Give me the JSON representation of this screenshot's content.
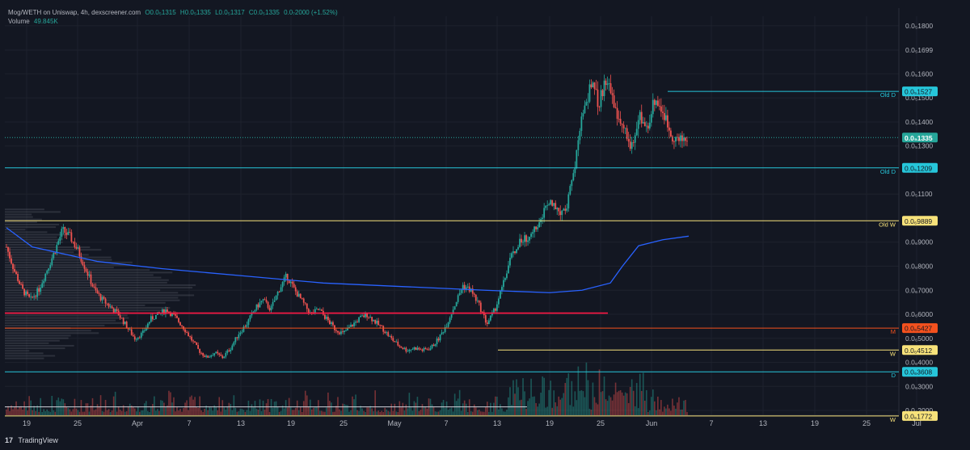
{
  "header": {
    "symbol": "Mog/WETH on Uniswap, 4h, dexscreener.com",
    "open": "O0.0₅1315",
    "high": "H0.0₅1335",
    "low": "L0.0₅1317",
    "close": "C0.0₅1335",
    "change": "0.0₇2000 (+1.52%)",
    "volume_label": "Volume",
    "volume_value": "49.845K"
  },
  "footer": {
    "logo": "17",
    "brand": "TradingView"
  },
  "colors": {
    "bg": "#131722",
    "up": "#26a69a",
    "down": "#ef5350",
    "ma": "#2962ff",
    "cyan": "#26c6da",
    "yellow": "#f7e27a",
    "orange": "#f4511e",
    "red": "#ff1744",
    "grid": "#1e222d"
  },
  "chart_data": {
    "type": "candlestick",
    "timeframe": "4h",
    "x_ticks": [
      "19",
      "25",
      "Apr",
      "7",
      "13",
      "19",
      "25",
      "May",
      "7",
      "13",
      "19",
      "25",
      "Jun",
      "7",
      "13",
      "19",
      "25",
      "Jul"
    ],
    "y_ticks": [
      "0.0₅1800",
      "0.0₅1699",
      "0.0₅1600",
      "0.0₅1500",
      "0.0₅1400",
      "0.0₅1300",
      "0.0₅1100",
      "0.0₆9000",
      "0.0₆8000",
      "0.0₆7000",
      "0.0₆6000",
      "0.0₆5000",
      "0.0₆4000",
      "0.0₆3000",
      "0.0₆2000"
    ],
    "y_tick_values": [
      1.8,
      1.699,
      1.6,
      1.5,
      1.4,
      1.3,
      1.1,
      0.9,
      0.8,
      0.7,
      0.6,
      0.5,
      0.4,
      0.3,
      0.2
    ],
    "ylim": [
      0.18,
      1.84
    ],
    "last_price": {
      "value": 1.335,
      "label": "0.0₅1335"
    },
    "levels": [
      {
        "value": 1.527,
        "label": "0.0₅1527",
        "tag": "Old D",
        "color": "#26c6da"
      },
      {
        "value": 1.209,
        "label": "0.0₅1209",
        "tag": "Old D",
        "color": "#26c6da"
      },
      {
        "value": 0.9889,
        "label": "0.0₆9889",
        "tag": "Old W",
        "color": "#f7e27a"
      },
      {
        "value": 0.5427,
        "label": "0.0₆5427",
        "tag": "M",
        "color": "#f4511e"
      },
      {
        "value": 0.4512,
        "label": "0.0₆4512",
        "tag": "W",
        "color": "#f7e27a"
      },
      {
        "value": 0.3608,
        "label": "0.0₆3608",
        "tag": "D",
        "color": "#26c6da"
      },
      {
        "value": 0.1772,
        "label": "0.0₆1772",
        "tag": "W",
        "color": "#f7e27a"
      }
    ],
    "price_path": [
      [
        0,
        0.88
      ],
      [
        1,
        0.78
      ],
      [
        2,
        0.7
      ],
      [
        3,
        0.66
      ],
      [
        4,
        0.7
      ],
      [
        5,
        0.78
      ],
      [
        6,
        0.86
      ],
      [
        7,
        0.95
      ],
      [
        8,
        0.92
      ],
      [
        9,
        0.86
      ],
      [
        10,
        0.78
      ],
      [
        11,
        0.7
      ],
      [
        12,
        0.66
      ],
      [
        13,
        0.63
      ],
      [
        14,
        0.6
      ],
      [
        15,
        0.55
      ],
      [
        16,
        0.5
      ],
      [
        17,
        0.52
      ],
      [
        18,
        0.58
      ],
      [
        19,
        0.6
      ],
      [
        20,
        0.62
      ],
      [
        21,
        0.59
      ],
      [
        22,
        0.55
      ],
      [
        23,
        0.5
      ],
      [
        24,
        0.45
      ],
      [
        25,
        0.42
      ],
      [
        26,
        0.44
      ],
      [
        27,
        0.42
      ],
      [
        28,
        0.46
      ],
      [
        29,
        0.52
      ],
      [
        30,
        0.56
      ],
      [
        31,
        0.62
      ],
      [
        32,
        0.66
      ],
      [
        33,
        0.62
      ],
      [
        34,
        0.7
      ],
      [
        35,
        0.76
      ],
      [
        36,
        0.7
      ],
      [
        37,
        0.65
      ],
      [
        38,
        0.6
      ],
      [
        39,
        0.62
      ],
      [
        40,
        0.58
      ],
      [
        41,
        0.54
      ],
      [
        42,
        0.52
      ],
      [
        43,
        0.55
      ],
      [
        44,
        0.58
      ],
      [
        45,
        0.6
      ],
      [
        46,
        0.57
      ],
      [
        47,
        0.54
      ],
      [
        48,
        0.5
      ],
      [
        49,
        0.47
      ],
      [
        50,
        0.45
      ],
      [
        51,
        0.46
      ],
      [
        52,
        0.45
      ],
      [
        53,
        0.46
      ],
      [
        54,
        0.5
      ],
      [
        55,
        0.56
      ],
      [
        56,
        0.64
      ],
      [
        57,
        0.72
      ],
      [
        58,
        0.7
      ],
      [
        59,
        0.64
      ],
      [
        60,
        0.56
      ],
      [
        61,
        0.62
      ],
      [
        62,
        0.72
      ],
      [
        63,
        0.84
      ],
      [
        64,
        0.9
      ],
      [
        65,
        0.92
      ],
      [
        66,
        0.96
      ],
      [
        67,
        1.02
      ],
      [
        68,
        1.08
      ],
      [
        69,
        1.02
      ],
      [
        70,
        1.06
      ],
      [
        71,
        1.22
      ],
      [
        72,
        1.45
      ],
      [
        73,
        1.55
      ],
      [
        74,
        1.48
      ],
      [
        75,
        1.6
      ],
      [
        76,
        1.44
      ],
      [
        77,
        1.38
      ],
      [
        78,
        1.3
      ],
      [
        79,
        1.42
      ],
      [
        80,
        1.38
      ],
      [
        81,
        1.5
      ],
      [
        82,
        1.44
      ],
      [
        83,
        1.35
      ],
      [
        84,
        1.32
      ],
      [
        85,
        1.335
      ]
    ]
  }
}
